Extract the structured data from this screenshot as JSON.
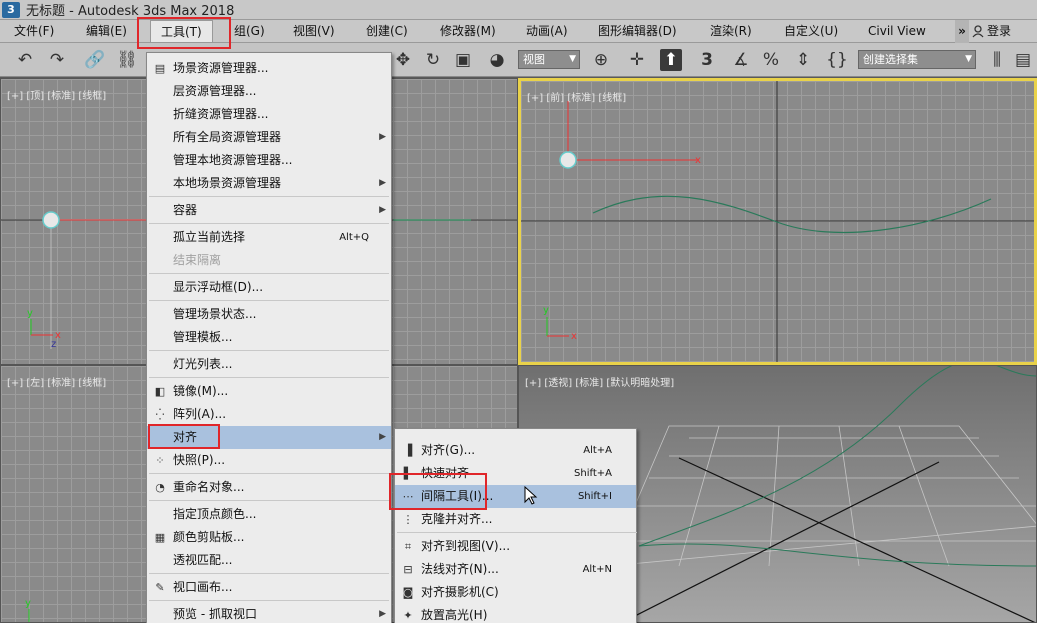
{
  "titlebar": {
    "icon": "3",
    "title": "无标题 - Autodesk 3ds Max 2018"
  },
  "menubar": {
    "items": [
      "文件(F)",
      "编辑(E)",
      "工具(T)",
      "组(G)",
      "视图(V)",
      "创建(C)",
      "修改器(M)",
      "动画(A)",
      "图形编辑器(D)",
      "渲染(R)",
      "自定义(U)",
      "Civil View"
    ],
    "overflow": "»",
    "login": "登录"
  },
  "toolbar": {
    "view_select": "视图",
    "selection_set": "创建选择集",
    "snap_label": "3"
  },
  "viewports": {
    "top": "[+] [顶] [标准] [线框]",
    "front": "[+] [前] [标准] [线框]",
    "left": "[+] [左] [标准] [线框]",
    "persp": "[+] [透视] [标准] [默认明暗处理]"
  },
  "tools_menu": {
    "items": [
      {
        "label": "场景资源管理器...",
        "icon": "table-icon"
      },
      {
        "label": "层资源管理器..."
      },
      {
        "label": "折缝资源管理器..."
      },
      {
        "label": "所有全局资源管理器",
        "submenu": true
      },
      {
        "label": "管理本地资源管理器..."
      },
      {
        "label": "本地场景资源管理器",
        "submenu": true
      },
      {
        "label": "容器",
        "submenu": true
      },
      {
        "label": "孤立当前选择",
        "shortcut": "Alt+Q"
      },
      {
        "label": "结束隔离",
        "disabled": true
      },
      {
        "label": "显示浮动框(D)..."
      },
      {
        "label": "管理场景状态..."
      },
      {
        "label": "管理模板..."
      },
      {
        "label": "灯光列表..."
      },
      {
        "label": "镜像(M)...",
        "icon": "mirror-icon"
      },
      {
        "label": "阵列(A)...",
        "icon": "array-icon"
      },
      {
        "label": "对齐",
        "submenu": true
      },
      {
        "label": "快照(P)...",
        "icon": "snapshot-icon"
      },
      {
        "label": "重命名对象...",
        "icon": "rename-icon"
      },
      {
        "label": "指定顶点颜色..."
      },
      {
        "label": "颜色剪贴板...",
        "icon": "color-clipboard-icon"
      },
      {
        "label": "透视匹配..."
      },
      {
        "label": "视口画布...",
        "icon": "brush-icon"
      },
      {
        "label": "预览 - 抓取视口",
        "submenu": true
      }
    ]
  },
  "align_menu": {
    "items": [
      {
        "label": "对齐(G)...",
        "shortcut": "Alt+A",
        "icon": "align-icon"
      },
      {
        "label": "快速对齐",
        "shortcut": "Shift+A",
        "icon": "quick-align-icon"
      },
      {
        "label": "间隔工具(I)...",
        "shortcut": "Shift+I",
        "icon": "spacing-tool-icon"
      },
      {
        "label": "克隆并对齐...",
        "icon": "clone-align-icon"
      },
      {
        "label": "对齐到视图(V)...",
        "icon": "align-view-icon"
      },
      {
        "label": "法线对齐(N)...",
        "shortcut": "Alt+N",
        "icon": "normal-align-icon"
      },
      {
        "label": "对齐摄影机(C)",
        "icon": "align-camera-icon"
      },
      {
        "label": "放置高光(H)",
        "icon": "place-highlight-icon"
      }
    ]
  },
  "colors": {
    "accent_red": "#e0262a",
    "active_viewport": "#e9d24a",
    "highlight": "#a9c1de"
  }
}
